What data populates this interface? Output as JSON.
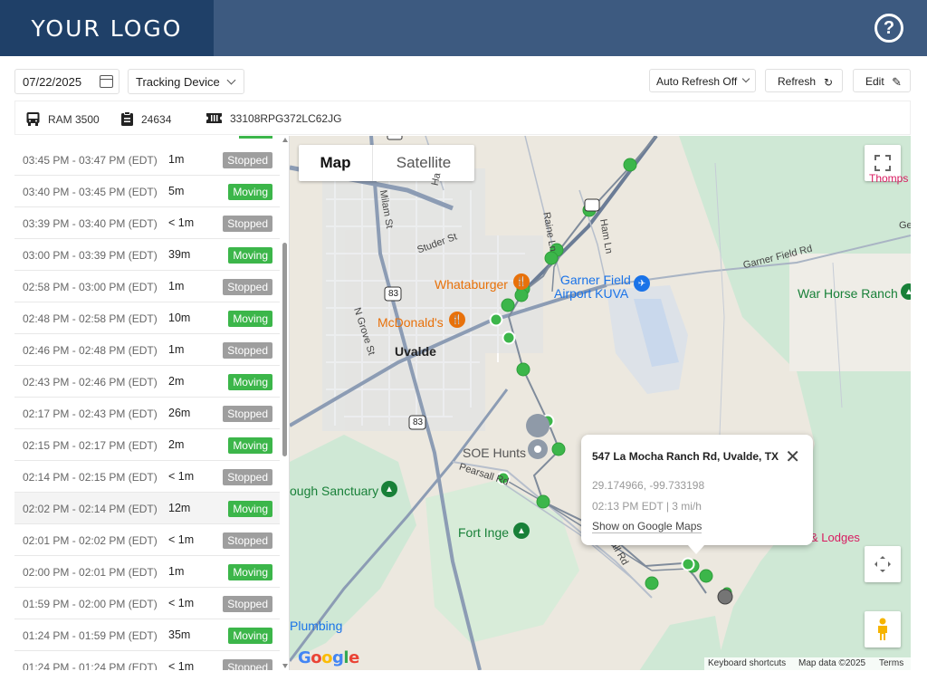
{
  "header": {
    "logo_text": "YOUR LOGO",
    "help_icon": "question-circle-icon",
    "help_glyph": "?"
  },
  "toolbar": {
    "date_value": "07/22/2025",
    "device_select_value": "Tracking Device",
    "auto_refresh_value": "Auto Refresh Off",
    "refresh_label": "Refresh",
    "edit_label": "Edit"
  },
  "vehicle": {
    "model": "RAM 3500",
    "unit_number": "24634",
    "vin": "33108RPG372LC62JG"
  },
  "status_colors": {
    "Moving": "#3cb64a",
    "Stopped": "#9e9e9e"
  },
  "trips": [
    {
      "time": "03:45 PM - 03:47 PM (EDT)",
      "duration": "1m",
      "status": "Stopped"
    },
    {
      "time": "03:40 PM - 03:45 PM (EDT)",
      "duration": "5m",
      "status": "Moving"
    },
    {
      "time": "03:39 PM - 03:40 PM (EDT)",
      "duration": "< 1m",
      "status": "Stopped"
    },
    {
      "time": "03:00 PM - 03:39 PM (EDT)",
      "duration": "39m",
      "status": "Moving"
    },
    {
      "time": "02:58 PM - 03:00 PM (EDT)",
      "duration": "1m",
      "status": "Stopped"
    },
    {
      "time": "02:48 PM - 02:58 PM (EDT)",
      "duration": "10m",
      "status": "Moving"
    },
    {
      "time": "02:46 PM - 02:48 PM (EDT)",
      "duration": "1m",
      "status": "Stopped"
    },
    {
      "time": "02:43 PM - 02:46 PM (EDT)",
      "duration": "2m",
      "status": "Moving"
    },
    {
      "time": "02:17 PM - 02:43 PM (EDT)",
      "duration": "26m",
      "status": "Stopped"
    },
    {
      "time": "02:15 PM - 02:17 PM (EDT)",
      "duration": "2m",
      "status": "Moving"
    },
    {
      "time": "02:14 PM - 02:15 PM (EDT)",
      "duration": "< 1m",
      "status": "Stopped"
    },
    {
      "time": "02:02 PM - 02:14 PM (EDT)",
      "duration": "12m",
      "status": "Moving",
      "selected": true
    },
    {
      "time": "02:01 PM - 02:02 PM (EDT)",
      "duration": "< 1m",
      "status": "Stopped"
    },
    {
      "time": "02:00 PM - 02:01 PM (EDT)",
      "duration": "1m",
      "status": "Moving"
    },
    {
      "time": "01:59 PM - 02:00 PM (EDT)",
      "duration": "< 1m",
      "status": "Stopped"
    },
    {
      "time": "01:24 PM - 01:59 PM (EDT)",
      "duration": "35m",
      "status": "Moving"
    },
    {
      "time": "01:24 PM - 01:24 PM (EDT)",
      "duration": "< 1m",
      "status": "Stopped"
    }
  ],
  "map": {
    "type_map": "Map",
    "type_satellite": "Satellite",
    "labels": {
      "uvalde": "Uvalde",
      "whataburger": "Whataburger",
      "mcdonalds": "McDonald's",
      "garner_field_1": "Garner Field",
      "garner_field_2": "Airport KUVA",
      "war_horse": "War Horse Ranch",
      "soe_hunts": "SOE Hunts",
      "sanctuary": "ough Sanctuary",
      "fort_inge": "Fort Inge",
      "lodges": "& Lodges",
      "plumbing": "Plumbing",
      "thomps": "Thomps",
      "garner_field_rd": "Garner Field Rd",
      "studer_st": "Studer St",
      "n_grove_st": "N Grove St",
      "milam_st": "Milam St",
      "raine_ln": "Raine Ln",
      "ham_ln": "Ham Ln",
      "pearsall_rd": "Pearsall Rd",
      "hwy_83_a": "83",
      "hwy_83_b": "83",
      "rd_frag_1": "Ha",
      "rd_frag_2": "Ge",
      "rd_frag_3": "all Rd"
    },
    "popup": {
      "address": "547 La Mocha Ranch Rd, Uvalde, TX",
      "coordinates": "29.174966, -99.733198",
      "time_speed": "02:13 PM EDT | 3 mi/h",
      "link": "Show on Google Maps"
    },
    "google_letters": [
      "G",
      "o",
      "o",
      "g",
      "l",
      "e"
    ],
    "google_colors": [
      "#4285f4",
      "#ea4335",
      "#fbbc05",
      "#4285f4",
      "#34a853",
      "#ea4335"
    ],
    "footer": {
      "shortcuts": "Keyboard shortcuts",
      "attribution": "Map data ©2025",
      "terms": "Terms"
    }
  }
}
